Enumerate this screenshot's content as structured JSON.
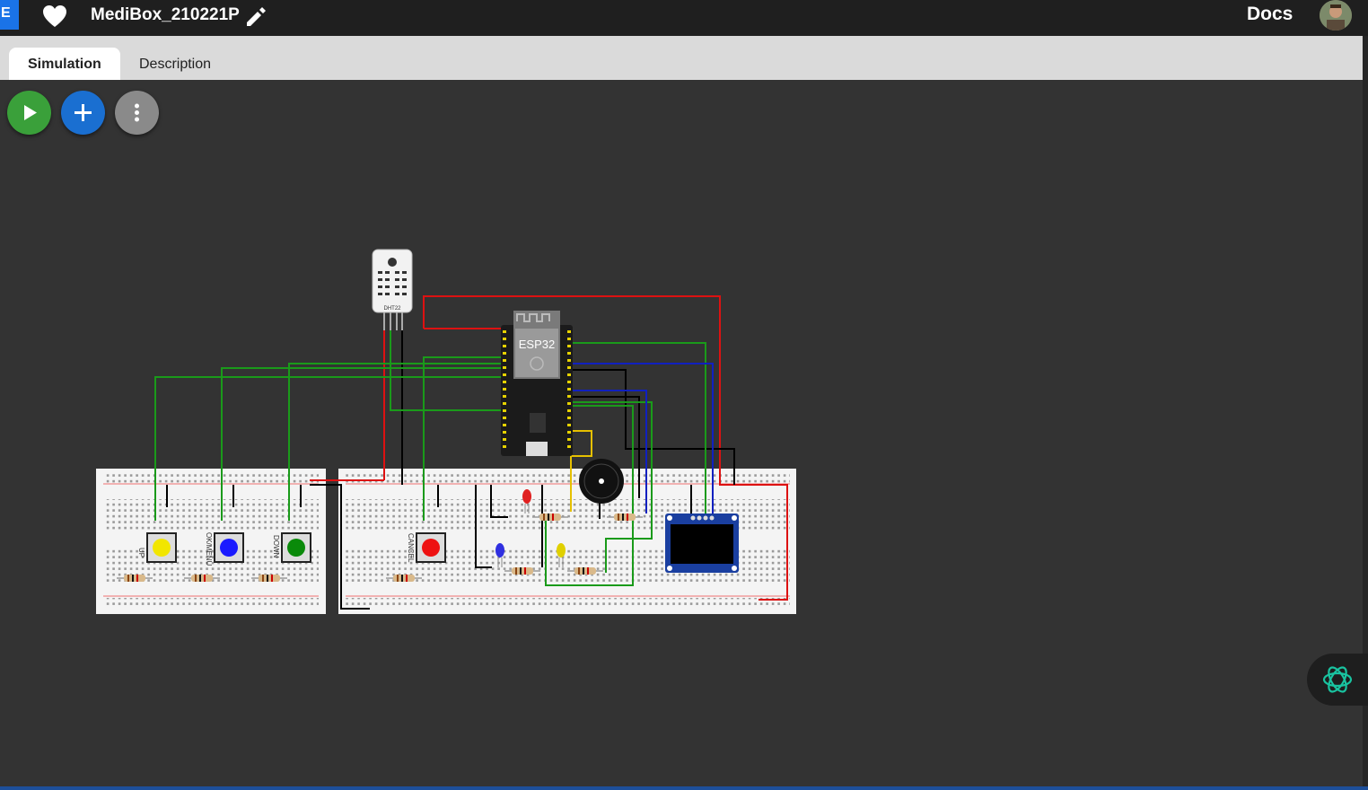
{
  "app": {
    "logo_letter": "E",
    "project_name": "MediBox_210221P",
    "docs_label": "Docs"
  },
  "tabs": [
    {
      "label": "Simulation",
      "active": true
    },
    {
      "label": "Description",
      "active": false
    }
  ],
  "toolbar": {
    "start_icon": "play-icon",
    "add_icon": "plus-icon",
    "more_icon": "more-vertical-icon"
  },
  "diagram": {
    "sensor_label": "DHT22",
    "mcu_label": "ESP32",
    "buttons": [
      {
        "label": "UP",
        "color": "#f2e600"
      },
      {
        "label": "OK/MENU",
        "color": "#1a1aff"
      },
      {
        "label": "DOWN",
        "color": "#0a8a0a"
      },
      {
        "label": "CANCEL",
        "color": "#ee1111"
      }
    ],
    "leds": [
      "#e02020",
      "#3030e0",
      "#e0d000"
    ],
    "wire_colors": {
      "ground": "#000000",
      "power": "#dd1111",
      "signal": "#1a9a1a",
      "data": "#1020c0",
      "buzzer": "#e6c000"
    }
  },
  "colors": {
    "accent": "#1a73e8",
    "play": "#3aa03a",
    "add": "#1a6fd1",
    "more": "#8a8a8a",
    "canvas": "#333333"
  }
}
